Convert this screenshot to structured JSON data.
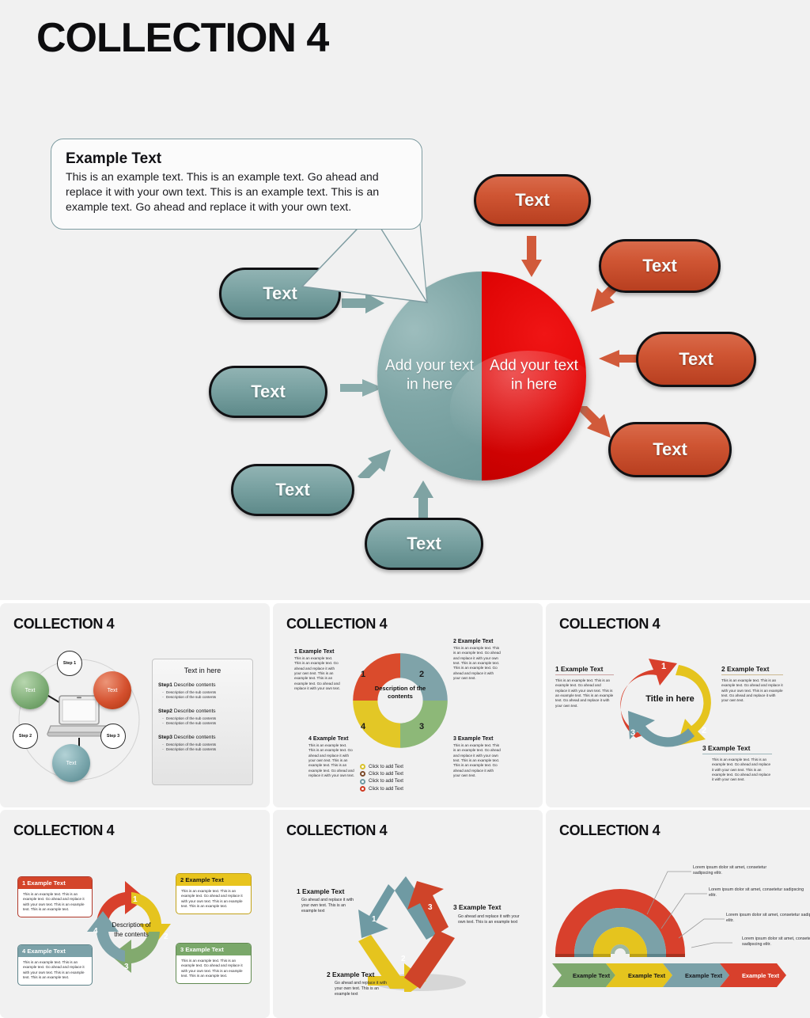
{
  "hero": {
    "title": "COLLECTION 4",
    "callout": {
      "title": "Example Text",
      "body": "This is an example text. This is an example text. Go ahead and replace it with your own text. This is an example text. This is an example text. Go ahead and replace it with your own text."
    },
    "center": {
      "left_label": "Add your text in here",
      "right_label": "Add your text in here",
      "left_color": "#7fa6a6",
      "right_color": "#e00505"
    },
    "teal_buttons": [
      {
        "label": "Text"
      },
      {
        "label": "Text"
      },
      {
        "label": "Text"
      },
      {
        "label": "Text"
      }
    ],
    "red_buttons": [
      {
        "label": "Text"
      },
      {
        "label": "Text"
      },
      {
        "label": "Text"
      },
      {
        "label": "Text"
      }
    ]
  },
  "thumbnails": [
    {
      "title": "COLLECTION 4",
      "panel_title": "Text in here",
      "spheres": [
        {
          "label": "Text",
          "color": "#7fae77"
        },
        {
          "label": "Text",
          "color": "#d4502e"
        },
        {
          "label": "Text",
          "color": "#7ba7ad"
        }
      ],
      "steps": [
        "Step 1",
        "Step 2",
        "Step 3"
      ],
      "sections": [
        {
          "bold": "Step1",
          "rest": "Describe contents",
          "bullets": [
            "Description of the sub contents",
            "Description of the sub contents"
          ]
        },
        {
          "bold": "Step2",
          "rest": "Describe contents",
          "bullets": [
            "Description of the sub contents",
            "Description of the sub contents"
          ]
        },
        {
          "bold": "Step3",
          "rest": "Describe contents",
          "bullets": [
            "Description of the sub contents",
            "Description of the sub contents"
          ]
        }
      ]
    },
    {
      "title": "COLLECTION 4",
      "donut_center": "Description of the contents",
      "numbers": [
        "1",
        "2",
        "3",
        "4"
      ],
      "blocks": [
        {
          "heading": "1 Example Text",
          "body": "This is an example text. This is an example text. Go ahead and replace it with your own text. This is an example text. This is an example text. Go ahead and replace it with your own text."
        },
        {
          "heading": "2 Example Text",
          "body": "This is an example text. This is an example text. Go ahead and replace it with your own text. This is an example text. This is an example text. Go ahead and replace it with your own text."
        },
        {
          "heading": "3 Example Text",
          "body": "This is an example text. This is an example text. Go ahead and replace it with your own text. This is an example text. This is an example text. Go ahead and replace it with your own text."
        },
        {
          "heading": "4 Example Text",
          "body": "This is an example text. This is an example text. Go ahead and replace it with your own text. This is an example text. This is an example text. Go ahead and replace it with your own text."
        }
      ],
      "legend": [
        {
          "label": "Click to add Text",
          "color": "#d9c22a"
        },
        {
          "label": "Click to add Text",
          "color": "#7b4a2a"
        },
        {
          "label": "Click to add Text",
          "color": "#6f9aa3"
        },
        {
          "label": "Click to add Text",
          "color": "#cf3a22"
        }
      ]
    },
    {
      "title": "COLLECTION 4",
      "center": "Title in here",
      "numbers": [
        "1",
        "2",
        "3"
      ],
      "blocks": [
        {
          "heading": "1 Example Text",
          "body": "This is an example text. This is an example text. Go ahead and replace it with your own text. This is an example text. This is an example text. Go ahead and replace it with your own text."
        },
        {
          "heading": "2 Example Text",
          "body": "This is an example text. This is an example text. Go ahead and replace it with your own text. This is an example text. Go ahead and replace it with your own text."
        },
        {
          "heading": "3 Example Text",
          "body": "This is an example text. This is an example text. Go ahead and replace it with your own text. This is an example text. Go ahead and replace it with your own text."
        }
      ]
    },
    {
      "title": "COLLECTION 4",
      "center": "Description of the contents",
      "numbers": [
        "1",
        "2",
        "3",
        "4"
      ],
      "boxes": [
        {
          "heading": "1 Example Text",
          "body": "This is an example text. This is an example text. Go ahead and replace it with your own text. This is an example text. This is an example text.",
          "color": "#d4452a"
        },
        {
          "heading": "2 Example Text",
          "body": "This is an example text. This is an example text. Go ahead and replace it with your own text. This is an example text. This is an example text.",
          "color": "#e8c41e"
        },
        {
          "heading": "3 Example Text",
          "body": "This is an example text. This is an example text. Go ahead and replace it with your own text. This is an example text. This is an example text.",
          "color": "#7aa86a"
        },
        {
          "heading": "4 Example Text",
          "body": "This is an example text. This is an example text. Go ahead and replace it with your own text. This is an example text. This is an example text.",
          "color": "#7ba1a8"
        }
      ]
    },
    {
      "title": "COLLECTION 4",
      "numbers": [
        "1",
        "2",
        "3"
      ],
      "blocks": [
        {
          "heading": "1 Example Text",
          "body": "Go ahead and replace it with your own text. This is an example text"
        },
        {
          "heading": "2 Example Text",
          "body": "Go ahead and replace it with your own text. This is an example text"
        },
        {
          "heading": "3 Example Text",
          "body": "Go ahead and replace it with your own text. This is an example text"
        }
      ]
    },
    {
      "title": "COLLECTION 4",
      "notes": [
        "Lorem ipsum dolor sit amet, consetetur sadipscing elitr.",
        "Lorem ipsum dolor sit amet, consetetur sadipscing elitr.",
        "Lorem ipsum dolor sit amet, consetetur sadipscing elitr.",
        "Lorem ipsum dolor sit amet, consetetur sadipscing elitr."
      ],
      "chevrons": [
        {
          "label": "Example Text",
          "color": "#7ea86e"
        },
        {
          "label": "Example Text",
          "color": "#e8c41e"
        },
        {
          "label": "Example Text",
          "color": "#7ba1a8"
        },
        {
          "label": "Example Text",
          "color": "#d4452a"
        }
      ]
    }
  ]
}
